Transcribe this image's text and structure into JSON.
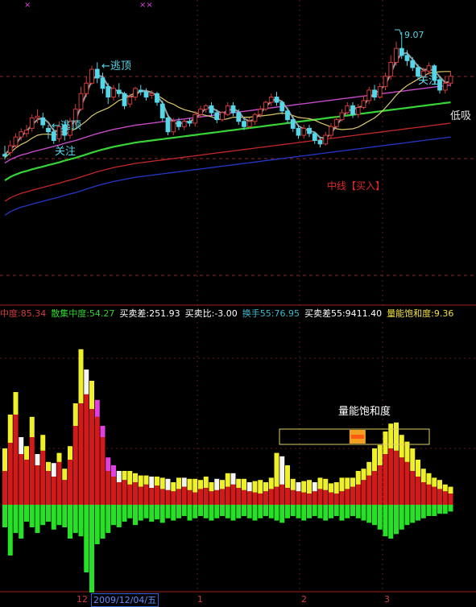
{
  "colors": {
    "bg": "#000000",
    "up": "#d23b3b",
    "down": "#54d7e8",
    "ma_yellow": "#d8c86a",
    "ma_magenta": "#c64ac6",
    "ma_green": "#37d437",
    "ma_red": "#c42828",
    "ma_blue": "#2636c8",
    "ma_gray": "#9a9a9a",
    "vol_red": "#d21a1a",
    "vol_yellow": "#f0f02a",
    "vol_white": "#f4f4f4",
    "vol_green": "#27e127",
    "vol_magenta": "#e040e0"
  },
  "annotations": {
    "escape_top_1": "←逃顶",
    "escape_top_2": "←逃顶",
    "watch_1": "关注",
    "watch_2": "关注",
    "low_buy": "低吸",
    "high_price": "9.07",
    "mid_buy": "中线【买入】",
    "gauge_label": "量能饱和度",
    "marker_1": "××",
    "marker_2": "×"
  },
  "indicator_bar": [
    {
      "label": "中度:",
      "value": "85.34",
      "color": "#d23b3b"
    },
    {
      "label": "散集中度:",
      "value": "54.27",
      "color": "#2fd32f"
    },
    {
      "label": "买卖差:",
      "value": "251.93",
      "color": "#ffffff"
    },
    {
      "label": "买卖比:",
      "value": "-3.00",
      "color": "#ffffff"
    },
    {
      "label": "换手",
      "value": "55:76.95",
      "color": "#3fb9d0"
    },
    {
      "label": "买卖差",
      "value": "55:9411.40",
      "color": "#ffffff"
    },
    {
      "label": "量能饱和度:",
      "value": "9.36",
      "color": "#f0e040"
    }
  ],
  "bottom_axis": {
    "month_12": "12",
    "date": "2009/12/04/五",
    "month_1": "1",
    "month_2": "2",
    "month_3": "3"
  },
  "gauge": {
    "level": 0.51
  },
  "chart_data": {
    "type": "candlestick",
    "ylim": [
      4.2,
      9.3
    ],
    "candles": [
      [
        5.55,
        5.5,
        5.8,
        5.4
      ],
      [
        5.6,
        5.8,
        5.95,
        5.5
      ],
      [
        5.8,
        6.05,
        6.15,
        5.7
      ],
      [
        6.05,
        6.2,
        6.3,
        5.95
      ],
      [
        6.15,
        6.25,
        6.4,
        6.05
      ],
      [
        6.3,
        6.6,
        6.7,
        6.2
      ],
      [
        6.6,
        6.65,
        6.85,
        6.45
      ],
      [
        6.6,
        6.4,
        6.75,
        6.3
      ],
      [
        6.3,
        6.2,
        6.4,
        6.0
      ],
      [
        6.2,
        5.95,
        6.3,
        5.85
      ],
      [
        6.0,
        6.35,
        6.5,
        5.9
      ],
      [
        6.4,
        6.1,
        6.5,
        5.95
      ],
      [
        6.1,
        6.5,
        6.6,
        6.0
      ],
      [
        6.5,
        6.85,
        7.0,
        6.4
      ],
      [
        6.85,
        7.3,
        7.5,
        6.8
      ],
      [
        7.3,
        7.6,
        7.8,
        7.2
      ],
      [
        7.6,
        8.0,
        8.1,
        7.55
      ],
      [
        8.0,
        7.75,
        8.2,
        7.6
      ],
      [
        7.75,
        7.45,
        7.9,
        7.3
      ],
      [
        7.5,
        7.2,
        7.6,
        7.0
      ],
      [
        7.2,
        7.45,
        7.55,
        7.1
      ],
      [
        7.4,
        7.3,
        7.6,
        7.2
      ],
      [
        7.3,
        6.95,
        7.35,
        6.85
      ],
      [
        7.0,
        7.2,
        7.3,
        6.9
      ],
      [
        7.2,
        7.45,
        7.5,
        7.1
      ],
      [
        7.4,
        7.35,
        7.55,
        7.25
      ],
      [
        7.35,
        7.2,
        7.45,
        7.1
      ],
      [
        7.25,
        7.3,
        7.4,
        7.15
      ],
      [
        7.3,
        7.05,
        7.35,
        6.95
      ],
      [
        7.0,
        6.6,
        7.1,
        6.5
      ],
      [
        6.6,
        6.2,
        6.7,
        6.1
      ],
      [
        6.2,
        6.5,
        6.6,
        6.1
      ],
      [
        6.5,
        6.35,
        6.6,
        6.25
      ],
      [
        6.35,
        6.5,
        6.55,
        6.25
      ],
      [
        6.5,
        6.45,
        6.6,
        6.35
      ],
      [
        6.45,
        6.7,
        6.8,
        6.35
      ],
      [
        6.7,
        6.85,
        6.95,
        6.6
      ],
      [
        6.85,
        6.95,
        7.0,
        6.75
      ],
      [
        6.95,
        6.75,
        7.05,
        6.65
      ],
      [
        6.75,
        6.55,
        6.85,
        6.45
      ],
      [
        6.55,
        6.75,
        6.8,
        6.5
      ],
      [
        6.7,
        6.95,
        7.05,
        6.65
      ],
      [
        6.95,
        6.75,
        7.05,
        6.65
      ],
      [
        6.75,
        6.5,
        6.85,
        6.4
      ],
      [
        6.5,
        6.35,
        6.6,
        6.25
      ],
      [
        6.35,
        6.5,
        6.6,
        6.3
      ],
      [
        6.5,
        6.7,
        6.75,
        6.4
      ],
      [
        6.7,
        6.85,
        6.95,
        6.6
      ],
      [
        6.85,
        7.05,
        7.1,
        6.8
      ],
      [
        7.05,
        7.2,
        7.3,
        6.95
      ],
      [
        7.2,
        7.05,
        7.35,
        6.95
      ],
      [
        7.05,
        6.8,
        7.1,
        6.7
      ],
      [
        6.8,
        6.55,
        6.9,
        6.45
      ],
      [
        6.55,
        6.3,
        6.65,
        6.2
      ],
      [
        6.3,
        6.1,
        6.4,
        6.0
      ],
      [
        6.1,
        6.3,
        6.4,
        6.0
      ],
      [
        6.3,
        6.15,
        6.4,
        6.05
      ],
      [
        6.15,
        5.95,
        6.2,
        5.85
      ],
      [
        5.95,
        5.85,
        6.05,
        5.75
      ],
      [
        5.85,
        6.1,
        6.2,
        5.8
      ],
      [
        6.1,
        6.35,
        6.45,
        6.0
      ],
      [
        6.35,
        6.55,
        6.65,
        6.3
      ],
      [
        6.55,
        6.75,
        6.85,
        6.5
      ],
      [
        6.75,
        6.95,
        7.05,
        6.7
      ],
      [
        6.95,
        6.7,
        7.05,
        6.6
      ],
      [
        6.7,
        6.9,
        7.0,
        6.6
      ],
      [
        6.9,
        7.1,
        7.25,
        6.85
      ],
      [
        7.1,
        7.4,
        7.5,
        7.0
      ],
      [
        7.4,
        7.2,
        7.55,
        7.1
      ],
      [
        7.2,
        7.5,
        7.6,
        7.15
      ],
      [
        7.5,
        7.8,
        7.9,
        7.4
      ],
      [
        7.8,
        8.2,
        8.4,
        7.7
      ],
      [
        8.2,
        8.6,
        8.8,
        8.1
      ],
      [
        8.6,
        8.4,
        9.07,
        8.3
      ],
      [
        8.4,
        8.25,
        8.55,
        8.1
      ],
      [
        8.25,
        8.05,
        8.35,
        7.95
      ],
      [
        8.05,
        7.8,
        8.15,
        7.7
      ],
      [
        7.8,
        7.95,
        8.05,
        7.6
      ],
      [
        7.95,
        8.1,
        8.2,
        7.85
      ],
      [
        8.1,
        7.7,
        8.15,
        7.55
      ],
      [
        7.7,
        7.4,
        7.8,
        7.3
      ],
      [
        7.4,
        7.6,
        7.8,
        7.3
      ],
      [
        7.6,
        7.8,
        7.95,
        7.5
      ]
    ],
    "ma_long": [
      4.95,
      5.05,
      5.12,
      5.18,
      5.22,
      5.27,
      5.31,
      5.35,
      5.39,
      5.43,
      5.47,
      5.52,
      5.56,
      5.6,
      5.65,
      5.7,
      5.75,
      5.8,
      5.84,
      5.88,
      5.92,
      5.95,
      5.98,
      6.01,
      6.04,
      6.06,
      6.08,
      6.1,
      6.12,
      6.14,
      6.16,
      6.18,
      6.2,
      6.22,
      6.24,
      6.26,
      6.28,
      6.3,
      6.32,
      6.34,
      6.36,
      6.38,
      6.4,
      6.42,
      6.44,
      6.46,
      6.48,
      6.5,
      6.52,
      6.54,
      6.56,
      6.58,
      6.6,
      6.62,
      6.64,
      6.66,
      6.68,
      6.7,
      6.72,
      6.74,
      6.76,
      6.78,
      6.8,
      6.82,
      6.84,
      6.86,
      6.88,
      6.9,
      6.92,
      6.94,
      6.96,
      6.98,
      7.0,
      7.02,
      7.04,
      7.06,
      7.08,
      7.1,
      7.12,
      7.14,
      7.16,
      7.18,
      7.2
    ]
  },
  "volume_data": {
    "up": [
      30,
      55,
      80,
      45,
      40,
      60,
      35,
      48,
      30,
      25,
      38,
      22,
      40,
      70,
      90,
      98,
      85,
      78,
      60,
      30,
      25,
      20,
      22,
      18,
      20,
      16,
      18,
      15,
      17,
      14,
      13,
      12,
      14,
      16,
      13,
      11,
      14,
      15,
      12,
      13,
      14,
      16,
      18,
      15,
      13,
      12,
      11,
      10,
      12,
      14,
      16,
      18,
      15,
      13,
      12,
      11,
      10,
      12,
      14,
      13,
      11,
      10,
      12,
      14,
      16,
      18,
      22,
      26,
      30,
      35,
      45,
      50,
      48,
      42,
      38,
      30,
      25,
      20,
      18,
      16,
      14,
      12,
      10
    ],
    "cap": [
      20,
      25,
      20,
      15,
      12,
      18,
      10,
      14,
      8,
      12,
      8,
      10,
      12,
      20,
      48,
      22,
      25,
      15,
      10,
      12,
      10,
      10,
      8,
      12,
      8,
      10,
      8,
      10,
      8,
      10,
      10,
      8,
      10,
      8,
      10,
      12,
      8,
      10,
      8,
      10,
      8,
      12,
      10,
      8,
      10,
      8,
      10,
      12,
      8,
      10,
      30,
      25,
      20,
      10,
      8,
      10,
      12,
      8,
      10,
      10,
      8,
      10,
      12,
      10,
      8,
      12,
      10,
      12,
      20,
      18,
      20,
      22,
      25,
      20,
      18,
      20,
      15,
      12,
      10,
      8,
      8,
      6,
      6
    ],
    "down": [
      20,
      45,
      25,
      30,
      15,
      20,
      25,
      18,
      15,
      22,
      18,
      20,
      30,
      25,
      28,
      60,
      80,
      35,
      30,
      25,
      18,
      20,
      15,
      12,
      18,
      14,
      12,
      15,
      13,
      16,
      12,
      14,
      12,
      10,
      14,
      12,
      10,
      12,
      14,
      12,
      10,
      12,
      14,
      12,
      10,
      12,
      14,
      12,
      10,
      12,
      14,
      16,
      12,
      10,
      12,
      14,
      12,
      10,
      12,
      14,
      12,
      10,
      14,
      12,
      10,
      12,
      14,
      16,
      18,
      22,
      28,
      30,
      26,
      22,
      18,
      16,
      14,
      12,
      10,
      10,
      8,
      8,
      6
    ]
  }
}
